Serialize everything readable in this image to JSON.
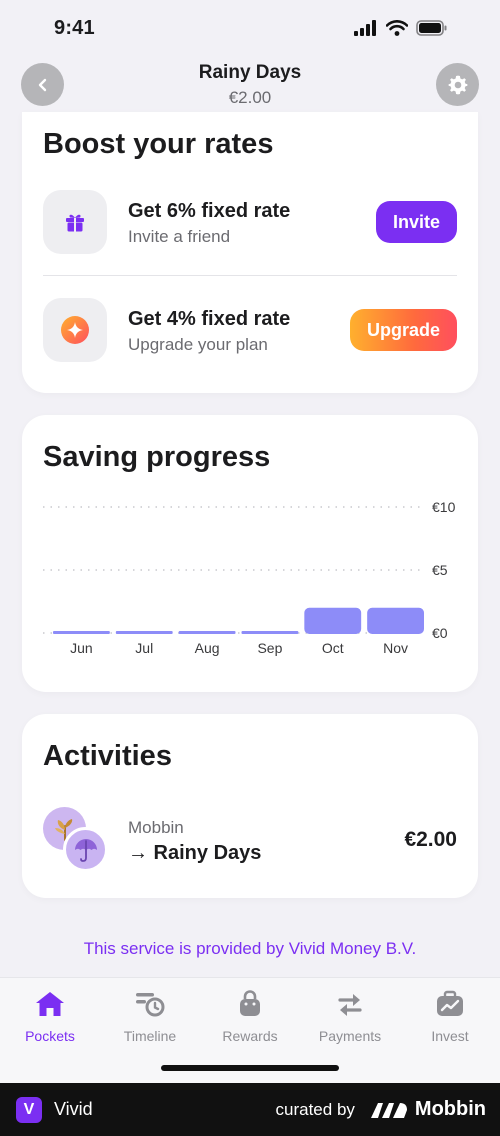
{
  "status_bar": {
    "time": "9:41"
  },
  "header": {
    "title": "Rainy Days",
    "balance": "€2.00"
  },
  "boost": {
    "title": "Boost your rates",
    "offers": [
      {
        "icon": "gift-icon",
        "title": "Get 6% fixed rate",
        "subtitle": "Invite a friend",
        "button": "Invite"
      },
      {
        "icon": "sparkle-icon",
        "title": "Get 4% fixed rate",
        "subtitle": "Upgrade your plan",
        "button": "Upgrade"
      }
    ]
  },
  "progress": {
    "title": "Saving progress",
    "chart_data": {
      "type": "bar",
      "categories": [
        "Jun",
        "Jul",
        "Aug",
        "Sep",
        "Oct",
        "Nov"
      ],
      "values": [
        0,
        0,
        0,
        0,
        2,
        2
      ],
      "ylim": [
        0,
        10
      ],
      "y_ticks": [
        "€10",
        "€5",
        "€0"
      ],
      "y_tick_values": [
        10,
        5,
        0
      ],
      "grid": "dotted horizontal",
      "bar_color": "#8d8cf8"
    }
  },
  "activities": {
    "title": "Activities",
    "items": [
      {
        "from": "Mobbin",
        "to": "→ Rainy Days",
        "amount": "€2.00"
      }
    ]
  },
  "provider_note": "This service is provided by Vivid Money B.V.",
  "tabs": [
    {
      "label": "Pockets",
      "icon": "home-icon",
      "active": true
    },
    {
      "label": "Timeline",
      "icon": "timeline-icon",
      "active": false
    },
    {
      "label": "Rewards",
      "icon": "bag-icon",
      "active": false
    },
    {
      "label": "Payments",
      "icon": "transfer-icon",
      "active": false
    },
    {
      "label": "Invest",
      "icon": "briefcase-chart-icon",
      "active": false
    }
  ],
  "footer": {
    "brand": "Vivid",
    "logo_letter": "V",
    "curated_by": "curated by",
    "mobbin": "Mobbin"
  },
  "colors": {
    "accent": "#7b2ff2",
    "chart_bar": "#8d8cf8"
  }
}
